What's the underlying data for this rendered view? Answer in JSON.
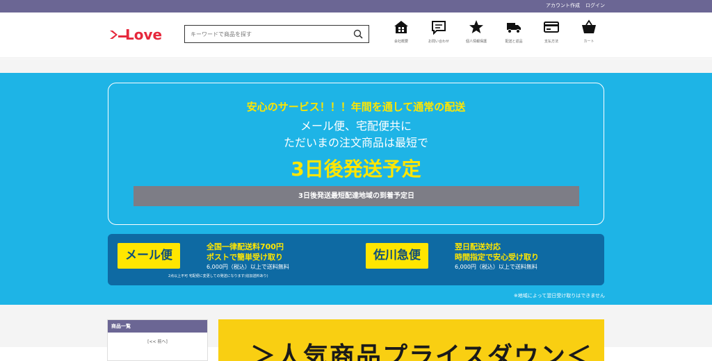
{
  "topbar": {
    "register": "アカウント作成",
    "login": "ログイン"
  },
  "search": {
    "placeholder": "キーワードで商品を探す"
  },
  "nav": [
    {
      "label": "会社概要",
      "icon": "home-icon"
    },
    {
      "label": "お問い合わせ",
      "icon": "chat-icon"
    },
    {
      "label": "個人情報保護",
      "icon": "star-icon"
    },
    {
      "label": "配送と返品",
      "icon": "truck-icon"
    },
    {
      "label": "支払方法",
      "icon": "credit-card-icon"
    },
    {
      "label": "カート",
      "icon": "cart-icon"
    }
  ],
  "promo": {
    "line1": "安心のサービス！！！年間を通して通常の配送",
    "line2": "メール便、宅配便共に",
    "line3": "ただいまの注文商品は最短で",
    "headline": "3日後発送予定",
    "bar": "3日後発送最短配達地域の到着予定日"
  },
  "shipping": {
    "mail": {
      "badge": "メール便",
      "title1": "全国一律配送料700円",
      "title2": "ポストで簡単受け取り",
      "free": "6,000円（税込）以上で送料無料",
      "note": "2点以上不可 宅配便に変更しての発送になります(追加送料あり)"
    },
    "sagawa": {
      "badge": "佐川急便",
      "title1": "翌日配送対応",
      "title2": "時間指定で安心受け取り",
      "free": "6,000円（税込）以上で送料無料"
    },
    "footnote": "※地域によって翌日受け取りはできません"
  },
  "sidebar": {
    "heading": "商品一覧",
    "prev": "[<< 前へ]"
  },
  "sale_banner": {
    "text": "＞人気商品プライスダウン＜"
  },
  "colors": {
    "topbar": "#6b6694",
    "banner": "#1eb4e6",
    "ship_bg": "#0e6aa3",
    "accent": "#ffe600"
  }
}
